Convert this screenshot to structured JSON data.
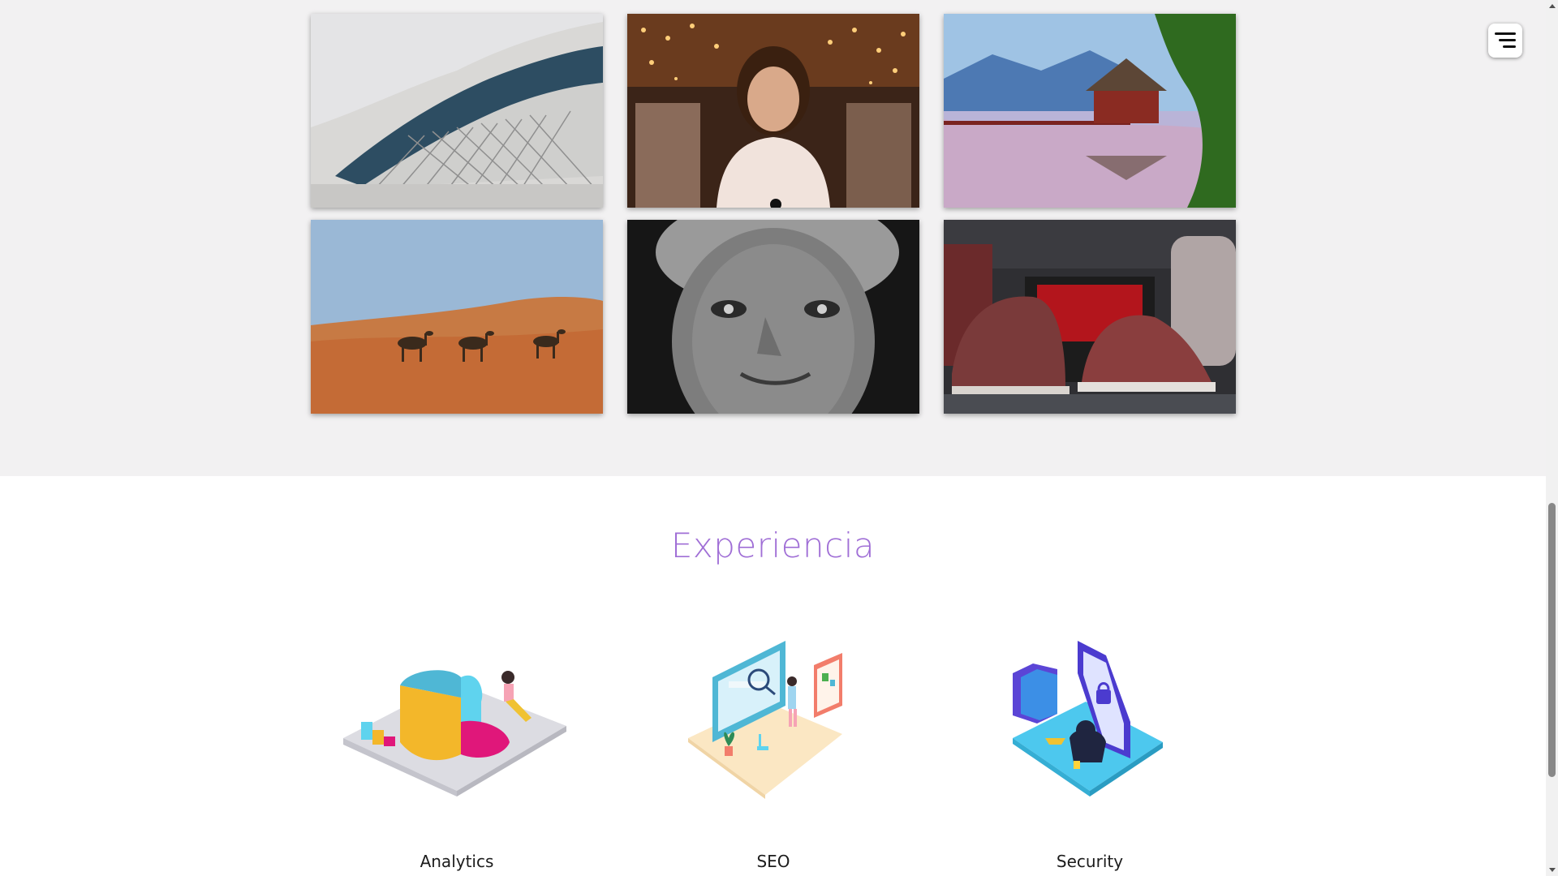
{
  "gallery": {
    "photos": [
      {
        "name": "architecture-photo"
      },
      {
        "name": "carousel-woman-photo"
      },
      {
        "name": "lake-house-photo"
      },
      {
        "name": "desert-camels-photo"
      },
      {
        "name": "elderly-woman-portrait-photo"
      },
      {
        "name": "sneakers-photo"
      }
    ]
  },
  "menu": {
    "icon": "hamburger-menu-icon"
  },
  "experience": {
    "title": "Experiencia",
    "services": [
      {
        "label": "Analytics",
        "icon": "analytics-illustration"
      },
      {
        "label": "SEO",
        "icon": "seo-illustration"
      },
      {
        "label": "Security",
        "icon": "security-illustration"
      }
    ]
  },
  "colors": {
    "accent": "#a06fd6",
    "gallery_bg": "#f2f1f2"
  }
}
